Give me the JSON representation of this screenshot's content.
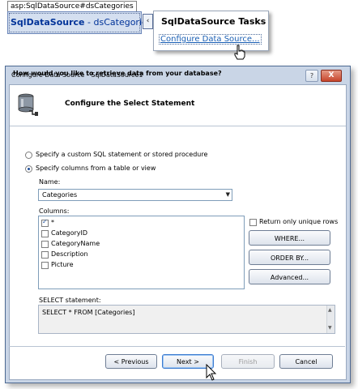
{
  "designer": {
    "control_tag": "asp:SqlDataSource#dsCategories",
    "control_name_bold": "SqlDataSource",
    "control_name_rest": " - dsCategories",
    "smart_tag_glyph": "‹",
    "tasks_title": "SqlDataSource Tasks",
    "tasks_link": "Configure Data Source..."
  },
  "dialog": {
    "title": "Configure Data Source - SqlDataSource1",
    "help_glyph": "?",
    "close_glyph": "X",
    "step_title": "Configure the Select Statement",
    "question": "How would you like to retrieve data from your database?",
    "option_custom": "Specify a custom SQL statement or stored procedure",
    "option_columns": "Specify columns from a table or view",
    "name_label": "Name:",
    "name_value": "Categories",
    "columns_label": "Columns:",
    "columns": [
      {
        "label": "*",
        "checked": true
      },
      {
        "label": "CategoryID",
        "checked": false
      },
      {
        "label": "CategoryName",
        "checked": false
      },
      {
        "label": "Description",
        "checked": false
      },
      {
        "label": "Picture",
        "checked": false
      }
    ],
    "unique_rows_label": "Return only unique rows",
    "where_button": "WHERE...",
    "orderby_button": "ORDER BY...",
    "advanced_button": "Advanced...",
    "select_label": "SELECT statement:",
    "select_value": "SELECT * FROM [Categories]",
    "previous_button": "< Previous",
    "next_button": "Next >",
    "finish_button": "Finish",
    "cancel_button": "Cancel"
  },
  "colors": {
    "dialog_frame": "#c9d5e6",
    "link": "#1a5fb4",
    "primary_border": "#3d7bd0"
  }
}
